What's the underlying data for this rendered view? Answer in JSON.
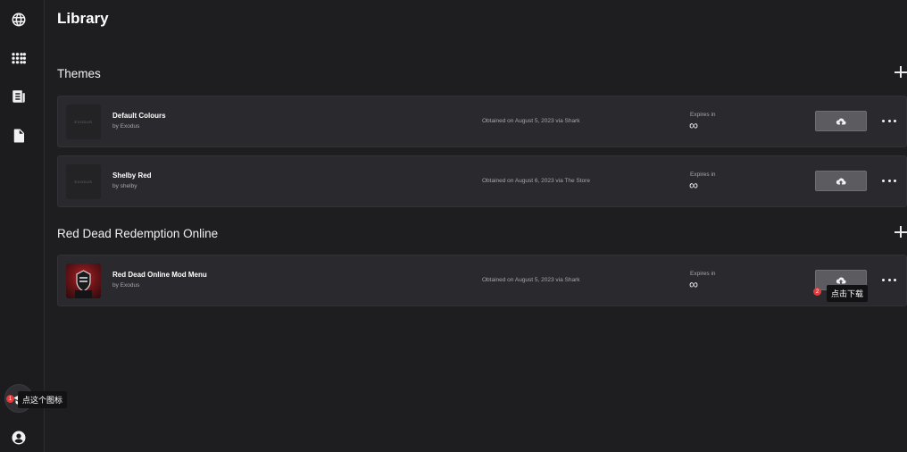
{
  "page": {
    "title": "Library"
  },
  "sidebar": {
    "icons": [
      "globe-icon",
      "apps-grid-icon",
      "newspaper-icon",
      "document-icon",
      "mod-icon",
      "account-icon"
    ]
  },
  "sections": [
    {
      "title": "Themes",
      "items": [
        {
          "name": "Default Colours",
          "author": "by Exodus",
          "thumb_text": "EXODUS",
          "obtained": "Obtained on August 5, 2023 via Shark",
          "expires_label": "Expires in",
          "expires_value": "∞"
        },
        {
          "name": "Shelby Red",
          "author": "by shelby",
          "thumb_text": "EXODUS",
          "obtained": "Obtained on August 6, 2023 via The Store",
          "expires_label": "Expires in",
          "expires_value": "∞"
        }
      ]
    },
    {
      "title": "Red Dead Redemption Online",
      "items": [
        {
          "name": "Red Dead Online Mod Menu",
          "author": "by Exodus",
          "obtained": "Obtained on August 5, 2023 via Shark",
          "expires_label": "Expires in",
          "expires_value": "∞"
        }
      ]
    }
  ],
  "annotations": {
    "step1": {
      "badge": "1",
      "text": "点这个图标"
    },
    "step2": {
      "badge": "2",
      "text": "点击下载"
    }
  }
}
